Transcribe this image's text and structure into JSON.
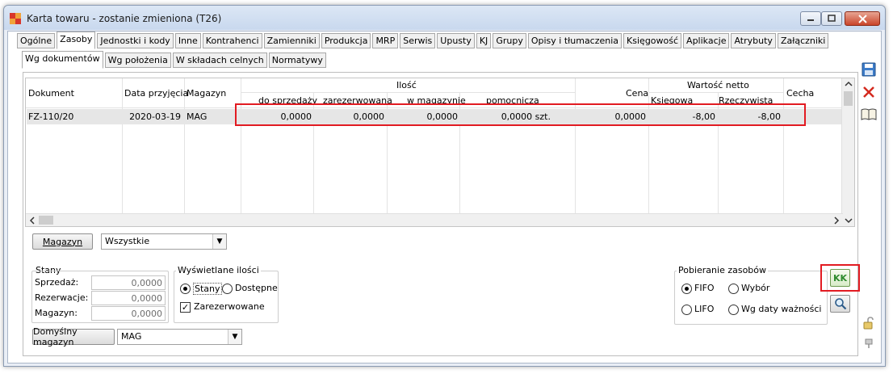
{
  "window": {
    "title": "Karta towaru - zostanie zmieniona (T26)"
  },
  "tabs": [
    "Ogólne",
    "Zasoby",
    "Jednostki i kody",
    "Inne",
    "Kontrahenci",
    "Zamienniki",
    "Produkcja",
    "MRP",
    "Serwis",
    "Upusty",
    "KJ",
    "Grupy",
    "Opisy i tłumaczenia",
    "Księgowość",
    "Aplikacje",
    "Atrybuty",
    "Załączniki"
  ],
  "active_tab": "Zasoby",
  "subtabs": [
    "Wg dokumentów",
    "Wg położenia",
    "W składach celnych",
    "Normatywy"
  ],
  "active_subtab": "Wg dokumentów",
  "grid": {
    "headers": {
      "dokument": "Dokument",
      "data": "Data przyjęcia",
      "magazyn": "Magazyn",
      "ilosc": "Ilość",
      "do_sprzedazy": "do sprzedaży",
      "zarezerwowana": "zarezerwowana",
      "w_magazynie": "w magazynie",
      "pomocnicza": "pomocnicza",
      "cena": "Cena",
      "wartosc_netto": "Wartość netto",
      "ksiegowa": "Księgowa",
      "rzeczywista": "Rzeczywista",
      "cecha": "Cecha"
    },
    "rows": [
      {
        "dokument": "FZ-110/20",
        "data": "2020-03-19",
        "magazyn": "MAG",
        "do_sprzedazy": "0,0000",
        "zarezerwowana": "0,0000",
        "w_magazynie": "0,0000",
        "pomocnicza": "0,0000 szt.",
        "cena": "0,0000",
        "ksiegowa": "-8,00",
        "rzeczywista": "-8,00",
        "cecha": ""
      }
    ]
  },
  "filter": {
    "magazyn_button": "Magazyn",
    "magazyn_value": "Wszystkie"
  },
  "stany": {
    "label": "Stany",
    "sprzedaz_label": "Sprzedaż:",
    "sprzedaz": "0,0000",
    "rezerwacje_label": "Rezerwacje:",
    "rezerwacje": "0,0000",
    "magazyn_label": "Magazyn:",
    "magazyn": "0,0000"
  },
  "wyswietlane": {
    "label": "Wyświetlane ilości",
    "stany": "Stany",
    "dostepne": "Dostępne",
    "zarezerwowane": "Zarezerwowane"
  },
  "domyslny": {
    "button": "Domyślny magazyn",
    "value": "MAG"
  },
  "pobieranie": {
    "label": "Pobieranie zasobów",
    "fifo": "FIFO",
    "wybor": "Wybór",
    "lifo": "LIFO",
    "wg_daty": "Wg daty ważności"
  },
  "kk_button": "KK",
  "colors": {
    "highlight": "#e21b22",
    "kk_green": "#2e8b2e"
  }
}
